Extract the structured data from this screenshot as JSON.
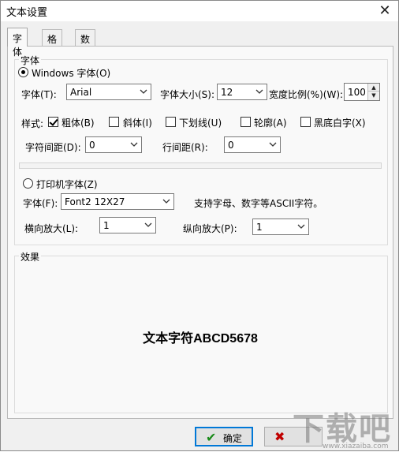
{
  "window": {
    "title": "文本设置",
    "close_symbol": "✕"
  },
  "tabs": [
    {
      "label": "字体",
      "active": true
    },
    {
      "label": "格式",
      "active": false
    },
    {
      "label": "数据源",
      "active": false
    }
  ],
  "font_group": {
    "label": "字体",
    "windows_font_radio": "Windows 字体(O)",
    "font_label": "字体(T):",
    "font_value": "Arial",
    "font_size_label": "字体大小(S):",
    "font_size_value": "12",
    "width_ratio_label": "宽度比例(%)(W):",
    "width_ratio_value": "100",
    "style_label": "样式:",
    "styles": [
      {
        "label": "粗体(B)",
        "checked": true
      },
      {
        "label": "斜体(I)",
        "checked": false
      },
      {
        "label": "下划线(U)",
        "checked": false
      },
      {
        "label": "轮廓(A)",
        "checked": false
      },
      {
        "label": "黑底白字(X)",
        "checked": false
      }
    ],
    "char_spacing_label": "字符间距(D):",
    "char_spacing_value": "0",
    "line_spacing_label": "行间距(R):",
    "line_spacing_value": "0",
    "printer_font_radio": "打印机字体(Z)",
    "printer_font_label": "字体(F):",
    "printer_font_value": "Font2  12X27",
    "printer_font_note": "支持字母、数字等ASCII字符。",
    "h_scale_label": "横向放大(L):",
    "h_scale_value": "1",
    "v_scale_label": "纵向放大(P):",
    "v_scale_value": "1"
  },
  "effect_group": {
    "label": "效果",
    "preview_text": "文本字符ABCD5678"
  },
  "buttons": {
    "ok_label": "确定",
    "ok_icon": "✔",
    "cancel_icon": "✖"
  },
  "watermark": {
    "text": "下载吧",
    "sub": "www.xiazaiba.com"
  },
  "colors": {
    "accent": "#0078d7",
    "ok_icon": "#1a8a1a",
    "cancel_icon": "#c00000"
  }
}
